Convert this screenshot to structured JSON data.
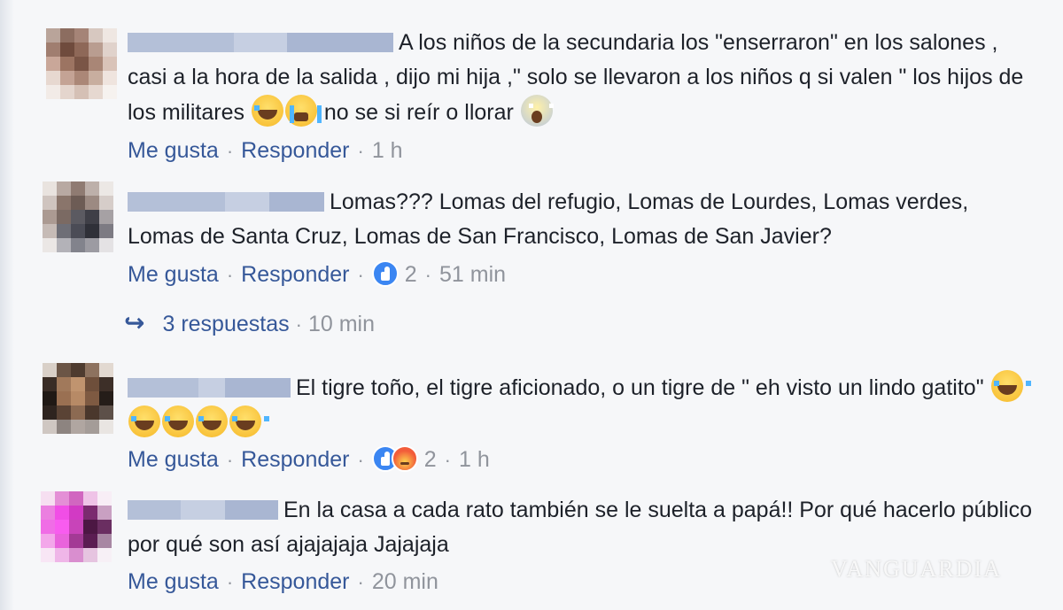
{
  "actions": {
    "like": "Me gusta",
    "reply": "Responder",
    "separator": "·"
  },
  "comments": [
    {
      "segments": [
        "A los niños de la secundaria los \"enserraron\" en los salones , casi a la hora de la salida , dijo mi hija ,\" solo se llevaron a los niños q si valen \" los hijos de los militares ",
        " no se si reír o llorar "
      ],
      "emojis": [
        "face-with-tears-of-joy-icon",
        "loudly-crying-face-icon",
        "face-screaming-icon"
      ],
      "time": "1 h"
    },
    {
      "segments": [
        "Lomas??? Lomas del refugio, Lomas de Lourdes, Lomas verdes, Lomas de Santa Cruz, Lomas de San Francisco, Lomas de San Javier?"
      ],
      "reaction_count": "2",
      "reactions": [
        "like-reaction-icon"
      ],
      "time": "51 min",
      "replies": {
        "count_label": "3 respuestas",
        "time": "10 min"
      }
    },
    {
      "segments": [
        "El tigre toño, el tigre aficionado, o un tigre de \" eh visto un lindo gatito\" "
      ],
      "emojis": [
        "face-with-tears-of-joy-icon",
        "face-with-tears-of-joy-icon",
        "face-with-tears-of-joy-icon",
        "face-with-tears-of-joy-icon",
        "face-with-tears-of-joy-icon"
      ],
      "reaction_count": "2",
      "reactions": [
        "like-reaction-icon",
        "angry-reaction-icon"
      ],
      "time": "1 h"
    },
    {
      "segments": [
        "En la casa a cada rato también se le suelta a papá!! Por qué hacerlo público por qué son así ajajajaja Jajajaja"
      ],
      "time": "20 min"
    }
  ],
  "watermark": "VANGUARDIA",
  "colors": {
    "link": "#365899",
    "meta": "#90949c",
    "text": "#1d2129",
    "background": "#f6f7f9"
  }
}
